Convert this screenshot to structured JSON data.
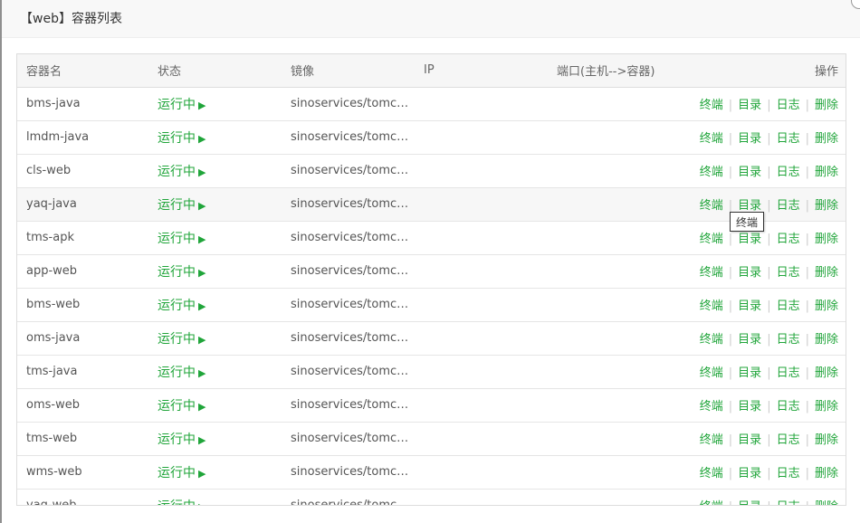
{
  "dialog": {
    "title": "【web】容器列表"
  },
  "table": {
    "headers": {
      "name": "容器名",
      "status": "状态",
      "image": "镜像",
      "ip": "IP",
      "ports": "端口(主机-->容器)",
      "ops": "操作"
    },
    "ops": {
      "terminal": "终端",
      "dir": "目录",
      "log": "日志",
      "delete": "删除"
    },
    "rows": [
      {
        "name": "bms-java",
        "status": "运行中",
        "image": "sinoservices/tomcat:...",
        "ip": "",
        "ports": ""
      },
      {
        "name": "lmdm-java",
        "status": "运行中",
        "image": "sinoservices/tomcat:...",
        "ip": "",
        "ports": ""
      },
      {
        "name": "cls-web",
        "status": "运行中",
        "image": "sinoservices/tomcat:...",
        "ip": "",
        "ports": ""
      },
      {
        "name": "yaq-java",
        "status": "运行中",
        "image": "sinoservices/tomcat:...",
        "ip": "",
        "ports": ""
      },
      {
        "name": "tms-apk",
        "status": "运行中",
        "image": "sinoservices/tomcat:...",
        "ip": "",
        "ports": ""
      },
      {
        "name": "app-web",
        "status": "运行中",
        "image": "sinoservices/tomcat:...",
        "ip": "",
        "ports": ""
      },
      {
        "name": "bms-web",
        "status": "运行中",
        "image": "sinoservices/tomcat:...",
        "ip": "",
        "ports": ""
      },
      {
        "name": "oms-java",
        "status": "运行中",
        "image": "sinoservices/tomcat:...",
        "ip": "",
        "ports": ""
      },
      {
        "name": "tms-java",
        "status": "运行中",
        "image": "sinoservices/tomcat:...",
        "ip": "",
        "ports": ""
      },
      {
        "name": "oms-web",
        "status": "运行中",
        "image": "sinoservices/tomcat:...",
        "ip": "",
        "ports": ""
      },
      {
        "name": "tms-web",
        "status": "运行中",
        "image": "sinoservices/tomcat:...",
        "ip": "",
        "ports": ""
      },
      {
        "name": "wms-web",
        "status": "运行中",
        "image": "sinoservices/tomcat:...",
        "ip": "",
        "ports": ""
      },
      {
        "name": "yaq-web",
        "status": "运行中",
        "image": "sinoservices/tomcat:...",
        "ip": "",
        "ports": ""
      }
    ]
  },
  "tooltip": {
    "text": "终端"
  },
  "colors": {
    "accent": "#20a53a",
    "header_bg": "#f6f6f6",
    "border": "#dddddd"
  }
}
